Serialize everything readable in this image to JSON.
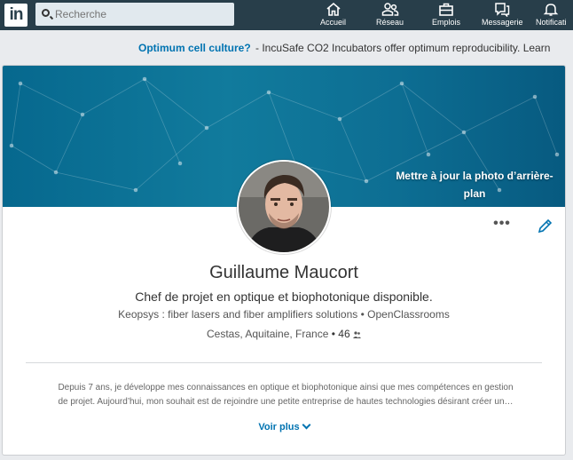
{
  "nav": {
    "logo_text": "in",
    "search_placeholder": "Recherche",
    "items": [
      {
        "label": "Accueil",
        "icon": "home-icon"
      },
      {
        "label": "Réseau",
        "icon": "network-icon"
      },
      {
        "label": "Emplois",
        "icon": "jobs-icon"
      },
      {
        "label": "Messagerie",
        "icon": "messaging-icon"
      },
      {
        "label": "Notificati",
        "icon": "notifications-icon"
      }
    ]
  },
  "ad": {
    "headline": "Optimum cell culture?",
    "body": "- IncuSafe CO2 Incubators offer optimum reproducibility. Learn"
  },
  "profile": {
    "update_background_label": "Mettre à jour la photo d’arrière-plan",
    "more_label": "•••",
    "name": "Guillaume Maucort",
    "headline": "Chef de projet en optique et biophotonique disponible.",
    "company_line": "Keopsys : fiber lasers and fiber amplifiers solutions • OpenClassrooms",
    "location": "Cestas, Aquitaine, France",
    "connections": "• 46",
    "summary_line1": "Depuis 7 ans, je développe mes connaissances en optique et biophotonique ainsi que mes compétences en gestion",
    "summary_line2": "de projet. Aujourd’hui, mon souhait est de rejoindre une petite entreprise de hautes technologies désirant créer un…",
    "see_more_label": "Voir plus"
  },
  "colors": {
    "nav_bg": "#283e4a",
    "link_blue": "#0073b1",
    "banner": "#0a6f95"
  }
}
